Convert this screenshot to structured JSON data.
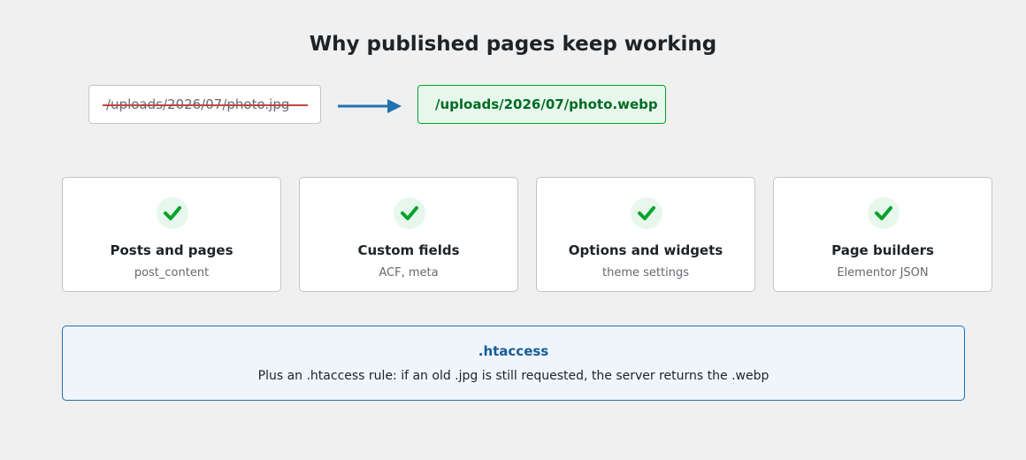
{
  "title": "Why published pages keep working",
  "rewrite": {
    "old_path": "/uploads/2026/07/photo.jpg",
    "new_path": "/uploads/2026/07/photo.webp",
    "old_status": "struck-through",
    "arrow_icon": "arrow-right-icon"
  },
  "colors": {
    "arrow": "#2271b1",
    "strike": "#c44343",
    "success": "#00a32a",
    "success_bg": "#e7f7ec",
    "info": "#135e96",
    "info_bg": "#f0f4fb"
  },
  "cards": [
    {
      "icon": "checkmark-icon",
      "title": "Posts and pages",
      "subtitle": "post_content"
    },
    {
      "icon": "checkmark-icon",
      "title": "Custom fields",
      "subtitle": "ACF, meta"
    },
    {
      "icon": "checkmark-icon",
      "title": "Options and widgets",
      "subtitle": "theme settings"
    },
    {
      "icon": "checkmark-icon",
      "title": "Page builders",
      "subtitle": "Elementor JSON"
    }
  ],
  "htaccess": {
    "title": ".htaccess",
    "text": "Plus an .htaccess rule: if an old .jpg is still requested, the server returns the .webp"
  }
}
